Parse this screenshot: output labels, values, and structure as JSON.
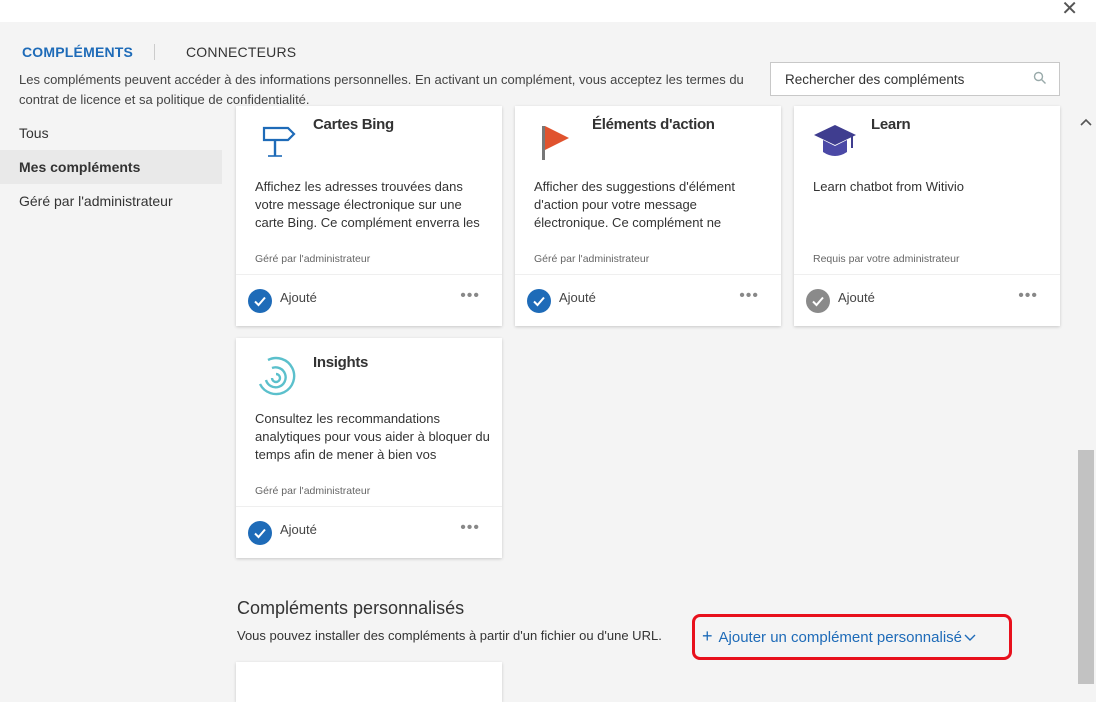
{
  "tabs": {
    "addins": "COMPLÉMENTS",
    "connectors": "CONNECTEURS"
  },
  "notice": "Les compléments peuvent accéder à des informations personnelles. En activant un complément, vous acceptez les termes du contrat de licence et sa politique de confidentialité.",
  "search": {
    "placeholder": "Rechercher des compléments"
  },
  "nav": {
    "items": [
      {
        "label": "Tous"
      },
      {
        "label": "Mes compléments"
      },
      {
        "label": "Géré par l'administrateur"
      }
    ]
  },
  "cards": [
    {
      "title": "Cartes Bing",
      "icon": "signpost-icon",
      "description": "Affichez les adresses trouvées dans votre message électronique sur une carte Bing. Ce complément enverra les",
      "managed": "Géré par l'administrateur",
      "status": "Ajouté",
      "more": "•••"
    },
    {
      "title": "Éléments d'action",
      "icon": "flag-icon",
      "description": "Afficher des suggestions d'élément d'action pour votre message électronique. Ce complément ne",
      "managed": "Géré par l'administrateur",
      "status": "Ajouté",
      "more": "•••"
    },
    {
      "title": "Learn",
      "icon": "graduation-cap-icon",
      "description": "Learn chatbot from Witivio",
      "managed": "Requis par votre administrateur",
      "status": "Ajouté",
      "more": "•••"
    },
    {
      "title": "Insights",
      "icon": "insights-icon",
      "description": "Consultez les recommandations analytiques pour vous aider à bloquer du temps afin de mener à bien vos",
      "managed": "Géré par l'administrateur",
      "status": "Ajouté",
      "more": "•••"
    }
  ],
  "custom": {
    "title": "Compléments personnalisés",
    "description": "Vous pouvez installer des compléments à partir d'un fichier ou d'une URL.",
    "add_plus": "+",
    "add_label": "Ajouter un complément personnalisé"
  },
  "colors": {
    "accent": "#1e6bb8",
    "highlight": "#e8101c",
    "check_required": "#8a8a8a"
  }
}
